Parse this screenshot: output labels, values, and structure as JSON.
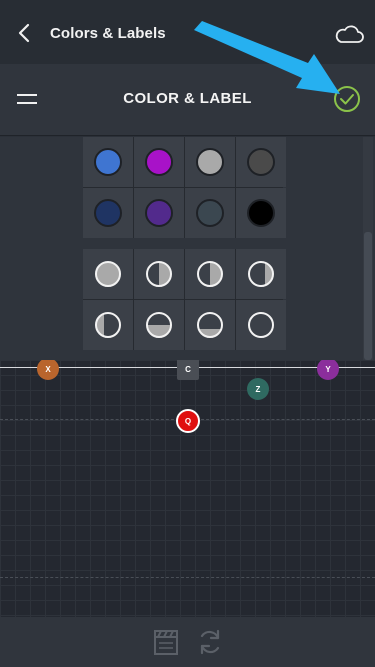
{
  "topbar": {
    "title": "Colors & Labels",
    "back_icon": "chevron-left-icon",
    "cloud_icon": "cloud-icon"
  },
  "panel": {
    "title": "COLOR & LABEL",
    "menu_icon": "hamburger-menu-icon",
    "confirm_icon": "check-circle-icon",
    "confirm_color": "#8bc34a"
  },
  "color_swatches": [
    "#3f75d1",
    "#a812c8",
    "#a9a9a9",
    "#4a4a4a",
    "#1f3463",
    "#522a8c",
    "#3b4750",
    "#000000"
  ],
  "fill_styles": [
    "full",
    "half-right",
    "half-right",
    "right-third",
    "left-third",
    "bottom-half",
    "bottom-third",
    "empty"
  ],
  "markers": [
    {
      "label": "X",
      "color": "#b9652d",
      "shape": "circle"
    },
    {
      "label": "C",
      "color": "#4a4e55",
      "shape": "square"
    },
    {
      "label": "Y",
      "color": "#8b2e9c",
      "shape": "circle"
    },
    {
      "label": "Z",
      "color": "#2f6a61",
      "shape": "circle"
    },
    {
      "label": "Q",
      "color": "#e01010",
      "shape": "circle"
    }
  ],
  "bottombar": {
    "icons": [
      "clapperboard-icon",
      "refresh-icon"
    ]
  },
  "annotation": {
    "arrow_color": "#26b0f0"
  }
}
